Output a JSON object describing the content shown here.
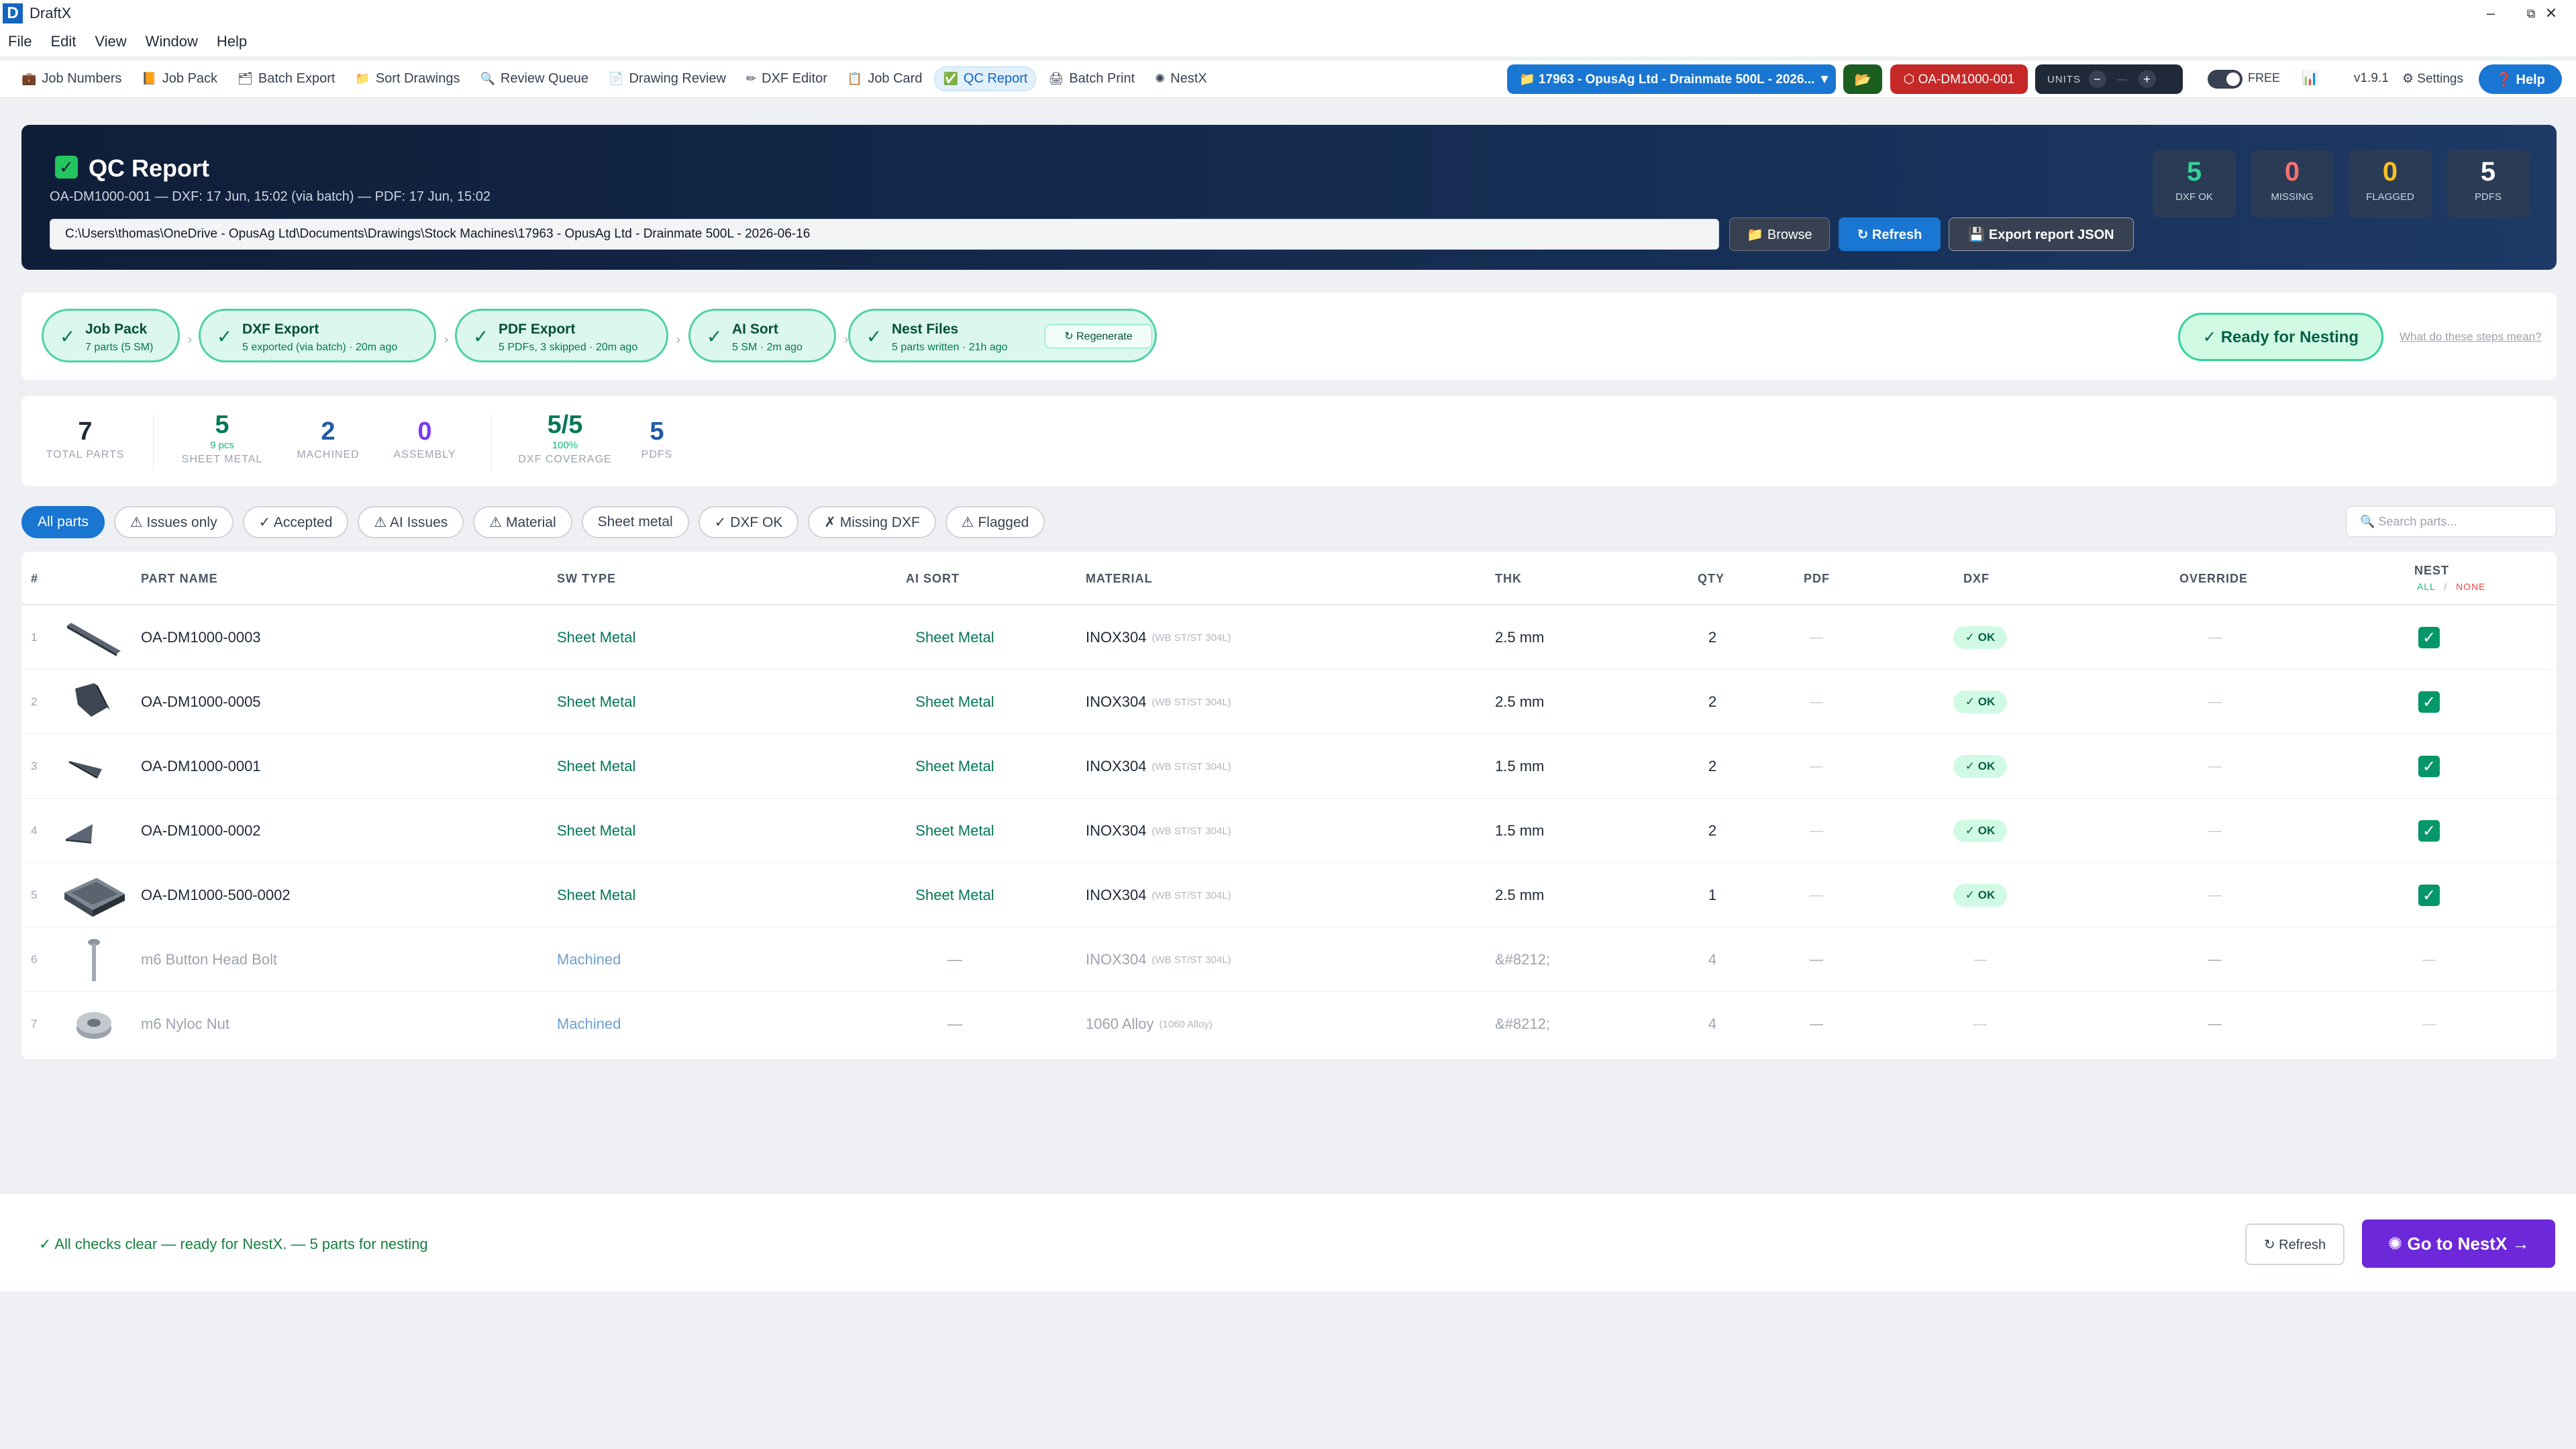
{
  "app": {
    "logo": "D",
    "title": "DraftX"
  },
  "window": {
    "minimize": "–",
    "restore": "⧉",
    "close": "✕"
  },
  "menu": [
    "File",
    "Edit",
    "View",
    "Window",
    "Help"
  ],
  "toolbar": [
    {
      "icon": "💼",
      "label": "Job Numbers"
    },
    {
      "icon": "📙",
      "label": "Job Pack"
    },
    {
      "icon": "🗂",
      "label": "Batch Export"
    },
    {
      "icon": "📁",
      "label": "Sort Drawings"
    },
    {
      "icon": "🔍",
      "label": "Review Queue"
    },
    {
      "icon": "📄",
      "label": "Drawing Review"
    },
    {
      "icon": "✏",
      "label": "DXF Editor"
    },
    {
      "icon": "📋",
      "label": "Job Card"
    },
    {
      "icon": "✅",
      "label": "QC Report",
      "active": true
    },
    {
      "icon": "🖨",
      "label": "Batch Print"
    },
    {
      "icon": "✺",
      "label": "NestX"
    }
  ],
  "header": {
    "job": "📁  17963 - OpusAg Ltd - Drainmate 500L - 2026...  ▼",
    "folder_icon": "📂",
    "part": "⬡  OA-DM1000-001",
    "units_label": "UNITS",
    "units_minus": "−",
    "units_value": "—",
    "units_plus": "+",
    "free": "FREE",
    "chart_icon": "📊",
    "version": "v1.9.1",
    "settings": "⚙ Settings",
    "help": "❓ Help"
  },
  "hero": {
    "check": "✓",
    "title": "QC Report",
    "subtitle": "OA-DM1000-001 — DXF: 17 Jun, 15:02 (via batch) — PDF: 17 Jun, 15:02",
    "path": "C:\\Users\\thomas\\OneDrive - OpusAg Ltd\\Documents\\Drawings\\Stock Machines\\17963 - OpusAg Ltd - Drainmate 500L - 2026-06-16",
    "browse": "📁 Browse",
    "refresh": "↻ Refresh",
    "export": "💾  Export report JSON",
    "stats": [
      {
        "value": "5",
        "label": "DXF OK",
        "color": "#34d399"
      },
      {
        "value": "0",
        "label": "MISSING",
        "color": "#f87171"
      },
      {
        "value": "0",
        "label": "FLAGGED",
        "color": "#fbbf24"
      },
      {
        "value": "5",
        "label": "PDFS",
        "color": "#ffffff"
      }
    ]
  },
  "steps": [
    {
      "check": "✓",
      "title": "Job Pack",
      "sub": "7 parts (5 SM)"
    },
    {
      "check": "✓",
      "title": "DXF Export",
      "sub": "5 exported (via batch) · 20m ago"
    },
    {
      "check": "✓",
      "title": "PDF Export",
      "sub": "5 PDFs, 3 skipped · 20m ago"
    },
    {
      "check": "✓",
      "title": "AI Sort",
      "sub": "5 SM · 2m ago"
    },
    {
      "check": "✓",
      "title": "Nest Files",
      "sub": "5 parts written · 21h ago",
      "action": "↻ Regenerate"
    }
  ],
  "step_sep": "›",
  "ready": "✓ Ready for Nesting",
  "steps_help": "What do these steps mean?",
  "summary": [
    {
      "value": "7",
      "sub": "",
      "label": "TOTAL PARTS",
      "color": "#1f2937"
    },
    {
      "value": "5",
      "sub": "9 pcs",
      "label": "SHEET METAL",
      "color": "#047857"
    },
    {
      "value": "2",
      "sub": "",
      "label": "MACHINED",
      "color": "#1e5aa8"
    },
    {
      "value": "0",
      "sub": "",
      "label": "ASSEMBLY",
      "color": "#7c3aed"
    },
    {
      "value": "5/5",
      "sub": "100%",
      "label": "DXF COVERAGE",
      "color": "#047857"
    },
    {
      "value": "5",
      "sub": "",
      "label": "PDFS",
      "color": "#1e5aa8"
    }
  ],
  "filters": [
    {
      "label": "All parts",
      "active": true
    },
    {
      "label": "⚠ Issues only"
    },
    {
      "label": "✓ Accepted"
    },
    {
      "label": "⚠ AI Issues"
    },
    {
      "label": "⚠ Material"
    },
    {
      "label": "Sheet metal"
    },
    {
      "label": "✓ DXF OK"
    },
    {
      "label": "✗ Missing DXF"
    },
    {
      "label": "⚠ Flagged"
    }
  ],
  "search_placeholder": "🔍  Search parts...",
  "columns": {
    "num": "#",
    "name": "PART NAME",
    "sw": "SW TYPE",
    "ai": "AI SORT",
    "material": "MATERIAL",
    "thk": "THK",
    "qty": "QTY",
    "pdf": "PDF",
    "dxf": "DXF",
    "override": "OVERRIDE",
    "nest": "NEST",
    "nest_all": "ALL",
    "nest_slash": "/",
    "nest_none": "NONE"
  },
  "rows": [
    {
      "num": "1",
      "thumb": "bar",
      "name": "OA-DM1000-0003",
      "sw": "Sheet Metal",
      "ai": "Sheet Metal",
      "mat": "INOX304",
      "mat_sub": "(WB ST/ST 304L)",
      "thk": "2.5 mm",
      "qty": "2",
      "pdf": "—",
      "dxf": "✓ OK",
      "override": "—",
      "nest": "✓"
    },
    {
      "num": "2",
      "thumb": "bracket",
      "name": "OA-DM1000-0005",
      "sw": "Sheet Metal",
      "ai": "Sheet Metal",
      "mat": "INOX304",
      "mat_sub": "(WB ST/ST 304L)",
      "thk": "2.5 mm",
      "qty": "2",
      "pdf": "—",
      "dxf": "✓ OK",
      "override": "—",
      "nest": "✓"
    },
    {
      "num": "3",
      "thumb": "wedge",
      "name": "OA-DM1000-0001",
      "sw": "Sheet Metal",
      "ai": "Sheet Metal",
      "mat": "INOX304",
      "mat_sub": "(WB ST/ST 304L)",
      "thk": "1.5 mm",
      "qty": "2",
      "pdf": "—",
      "dxf": "✓ OK",
      "override": "—",
      "nest": "✓"
    },
    {
      "num": "4",
      "thumb": "triangle",
      "name": "OA-DM1000-0002",
      "sw": "Sheet Metal",
      "ai": "Sheet Metal",
      "mat": "INOX304",
      "mat_sub": "(WB ST/ST 304L)",
      "thk": "1.5 mm",
      "qty": "2",
      "pdf": "—",
      "dxf": "✓ OK",
      "override": "—",
      "nest": "✓"
    },
    {
      "num": "5",
      "thumb": "tray",
      "name": "OA-DM1000-500-0002",
      "sw": "Sheet Metal",
      "ai": "Sheet Metal",
      "mat": "INOX304",
      "mat_sub": "(WB ST/ST 304L)",
      "thk": "2.5 mm",
      "qty": "1",
      "pdf": "—",
      "dxf": "✓ OK",
      "override": "—",
      "nest": "✓"
    },
    {
      "num": "6",
      "thumb": "bolt",
      "name": "m6 Button Head Bolt",
      "sw": "Machined",
      "ai": "—",
      "mat": "INOX304",
      "mat_sub": "(WB ST/ST 304L)",
      "thk": "&#8212;",
      "qty": "4",
      "pdf": "—",
      "dxf": "—",
      "override": "—",
      "nest": "—",
      "dim": true
    },
    {
      "num": "7",
      "thumb": "nut",
      "name": "m6 Nyloc Nut",
      "sw": "Machined",
      "ai": "—",
      "mat": "1060 Alloy",
      "mat_sub": "(1060 Alloy)",
      "thk": "&#8212;",
      "qty": "4",
      "pdf": "—",
      "dxf": "—",
      "override": "—",
      "nest": "—",
      "dim": true
    }
  ],
  "footer": {
    "message": "✓ All checks clear — ready for NestX. — 5 parts for nesting",
    "refresh": "↻ Refresh",
    "goto": "✺  Go to NestX →"
  }
}
